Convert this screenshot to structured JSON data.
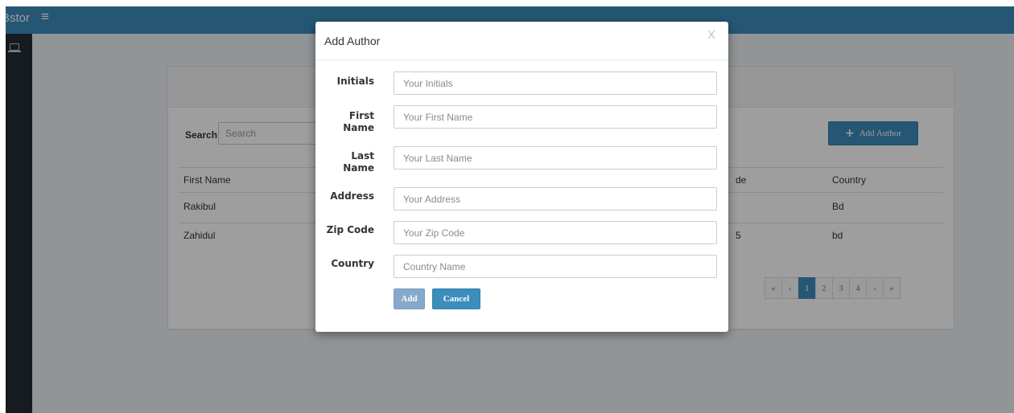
{
  "header": {
    "brand": "Bstor",
    "menu_icon": "hamburger-icon"
  },
  "sidebar": {
    "items": [
      {
        "icon": "laptop-icon"
      }
    ]
  },
  "main": {
    "search": {
      "label": "Search",
      "placeholder": "Search"
    },
    "add_author_button": {
      "label": "Add  Author",
      "icon": "plus-icon"
    },
    "table": {
      "columns": [
        "First Name",
        "",
        "Country"
      ],
      "partial_column_fragment": "de",
      "rows": [
        {
          "first_name": "Rakibul",
          "partial": "",
          "country": "Bd"
        },
        {
          "first_name": "Zahidul",
          "partial": "5",
          "country": "bd"
        }
      ]
    },
    "pagination": {
      "items": [
        "«",
        "‹",
        "1",
        "2",
        "3",
        "4",
        "›",
        "»"
      ],
      "active": "1"
    }
  },
  "modal": {
    "title": "Add Author",
    "close_label": "X",
    "fields": [
      {
        "label": "Initials",
        "placeholder": "Your Initials"
      },
      {
        "label": "First\nName",
        "placeholder": "Your First Name"
      },
      {
        "label": "Last\nName",
        "placeholder": "Your Last Name"
      },
      {
        "label": "Address",
        "placeholder": "Your Address"
      },
      {
        "label": "Zip Code",
        "placeholder": "Your Zip Code"
      },
      {
        "label": "Country",
        "placeholder": "Country Name"
      }
    ],
    "buttons": {
      "add": "Add",
      "cancel": "Cancel"
    }
  },
  "colors": {
    "primary": "#3c8dbc",
    "sidebar": "#222d32",
    "background": "#ecf0f5",
    "disabled_button": "#85a9ca"
  }
}
